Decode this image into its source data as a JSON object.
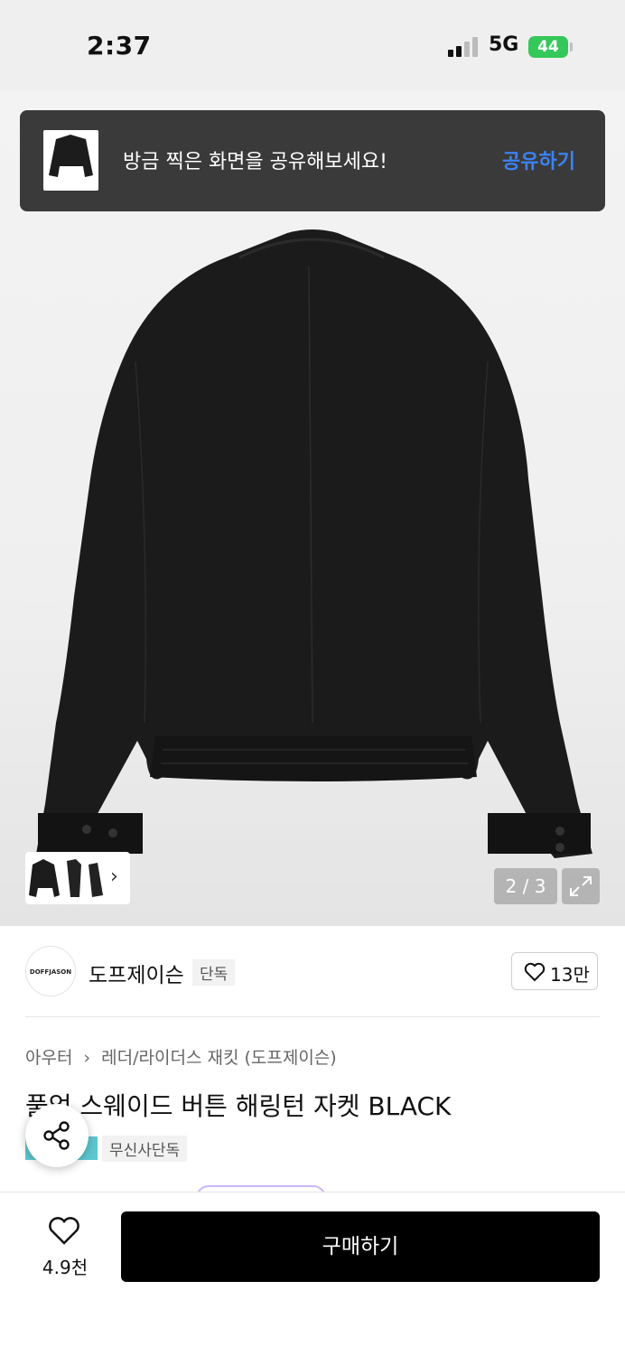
{
  "status_bar": {
    "time": "2:37",
    "network": "5G",
    "battery": "44"
  },
  "toast": {
    "message": "방금 찍은 화면을 공유해보세요!",
    "action_label": "공유하기"
  },
  "gallery": {
    "counter": "2 / 3",
    "thumb_arrow": "›"
  },
  "brand": {
    "logo_text": "DOFFJASON",
    "name": "도프제이슨",
    "tag": "단독"
  },
  "likes": {
    "count": "13만"
  },
  "product": {
    "breadcrumb_category": "아우터",
    "breadcrumb_separator": "›",
    "breadcrumb_sub": "레더/라이더스 재킷 (도프제이슨)",
    "title": "풀업 스웨이드 버튼 해링턴 자켓 BLACK",
    "tag": "무신사단독"
  },
  "bottom_bar": {
    "wishlist_count": "4.9천",
    "buy_label": "구매하기"
  },
  "colors": {
    "accent_blue": "#3b82f6",
    "battery_green": "#34c759",
    "teal_tag": "#5ec6cf"
  },
  "icons": [
    "signal-icon",
    "battery-icon",
    "heart-icon",
    "expand-icon",
    "share-icon",
    "chevron-right-icon"
  ]
}
